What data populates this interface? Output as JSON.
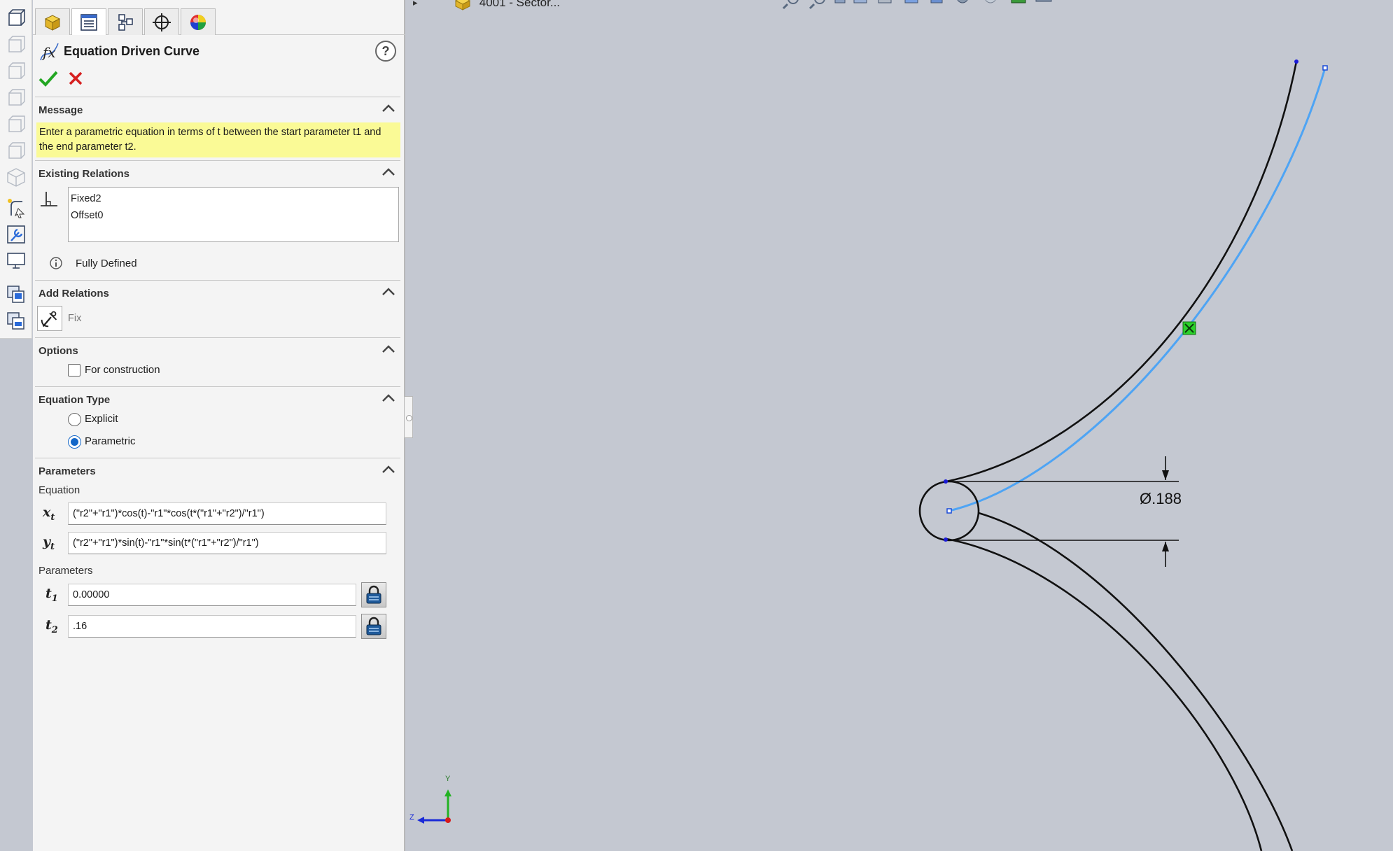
{
  "feature": {
    "title": "Equation Driven Curve"
  },
  "message": {
    "title": "Message",
    "text": "Enter a parametric equation in terms of t between the start parameter t1 and the end parameter t2."
  },
  "existing_relations": {
    "title": "Existing Relations",
    "items": [
      "Fixed2",
      "Offset0"
    ],
    "status": "Fully Defined"
  },
  "add_relations": {
    "title": "Add Relations",
    "fix_label": "Fix"
  },
  "options": {
    "title": "Options",
    "for_construction_label": "For construction",
    "for_construction_checked": false
  },
  "equation_type": {
    "title": "Equation Type",
    "explicit_label": "Explicit",
    "parametric_label": "Parametric",
    "selected": "Parametric"
  },
  "parameters": {
    "title": "Parameters",
    "equation_label": "Equation",
    "xt_value": "(\"r2\"+\"r1\")*cos(t)-\"r1\"*cos(t*(\"r1\"+\"r2\")/\"r1\")",
    "yt_value": "(\"r2\"+\"r1\")*sin(t)-\"r1\"*sin(t*(\"r1\"+\"r2\")/\"r1\")",
    "parameters_label": "Parameters",
    "t1_value": "0.00000",
    "t2_value": ".16"
  },
  "graphics": {
    "tree_label": "4001 - Sector...",
    "dimension_label": "Ø.188",
    "axis_y": "Y",
    "axis_z": "Z"
  },
  "colors": {
    "message_bg": "#fafa96",
    "selected_curve": "#4ea4f4",
    "sketch_line": "#111111",
    "ok_green": "#22a622",
    "cancel_red": "#d62020",
    "radio_blue": "#1467c8"
  }
}
